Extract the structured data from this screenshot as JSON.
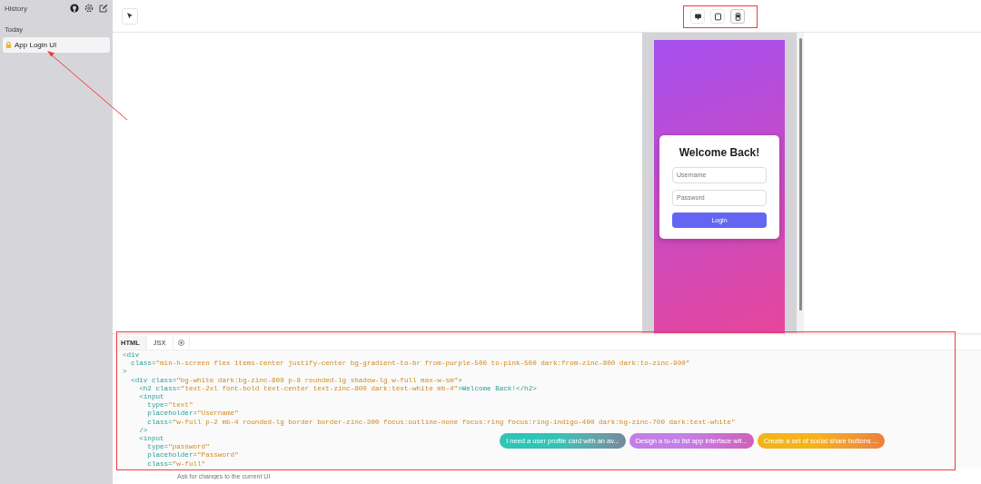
{
  "sidebar": {
    "title": "History",
    "section": "Today",
    "items": [
      {
        "label": "App Login UI",
        "selected": true
      }
    ]
  },
  "devices": [
    {
      "kind": "desktop",
      "selected": false
    },
    {
      "kind": "tablet",
      "selected": false
    },
    {
      "kind": "phone",
      "selected": true
    }
  ],
  "preview": {
    "title": "Welcome Back!",
    "fields": [
      {
        "placeholder": "Username"
      },
      {
        "placeholder": "Password"
      }
    ],
    "button": "Login"
  },
  "code": {
    "tabs": [
      {
        "label": "HTML",
        "selected": true
      },
      {
        "label": "JSX",
        "selected": false
      }
    ],
    "lines": [
      "<div",
      "  class=\"min-h-screen flex items-center justify-center bg-gradient-to-br from-purple-500 to-pink-500 dark:from-zinc-800 dark:to-zinc-900\"",
      ">",
      "  <div class=\"bg-white dark:bg-zinc-800 p-8 rounded-lg shadow-lg w-full max-w-sm\">",
      "    <h2 class=\"text-2xl font-bold text-center text-zinc-800 dark:text-white mb-4\">Welcome Back!</h2>",
      "    <input",
      "      type=\"text\"",
      "      placeholder=\"Username\"",
      "      class=\"w-full p-2 mb-4 rounded-lg border border-zinc-300 focus:outline-none focus:ring focus:ring-indigo-400 dark:bg-zinc-700 dark:text-white\"",
      "    />",
      "    <input",
      "      type=\"password\"",
      "      placeholder=\"Password\"",
      "      class=\"w-full\""
    ]
  },
  "suggestions": [
    {
      "label": "I need a user profile card with an av...",
      "color": "#2ec4b6"
    },
    {
      "label": "Design a to-do list app interface wit...",
      "color": "#c47ee8"
    },
    {
      "label": "Create a set of social share buttons ...",
      "color": "#f5b31a"
    }
  ],
  "prompt": {
    "placeholder": "Ask for changes to the current UI"
  }
}
